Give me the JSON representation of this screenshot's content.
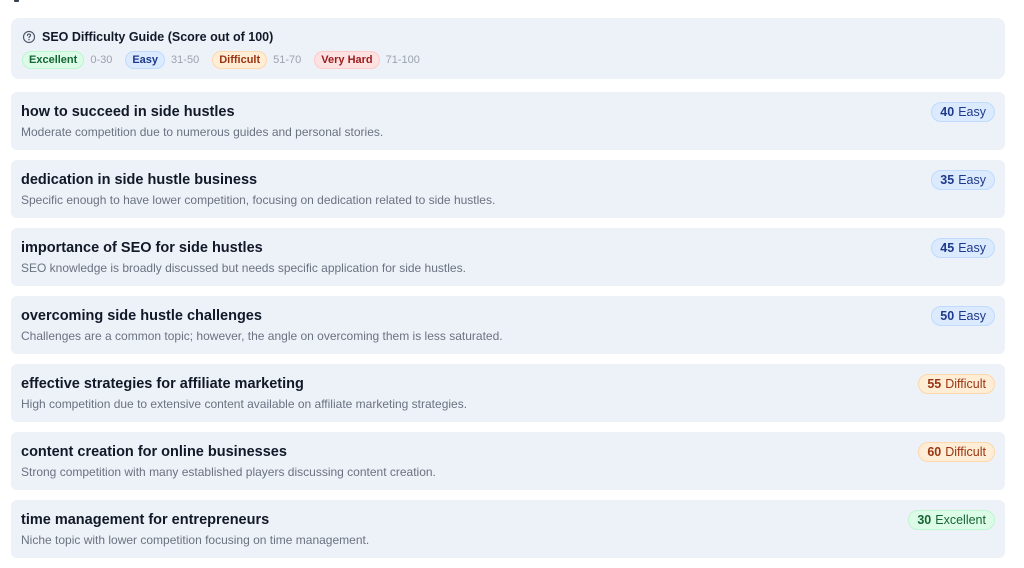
{
  "guide": {
    "title": "SEO Difficulty Guide (Score out of 100)",
    "levels": [
      {
        "label": "Excellent",
        "range": "0-30",
        "bg": "#dcfce7",
        "fg": "#166534",
        "border": "#bbf7d0"
      },
      {
        "label": "Easy",
        "range": "31-50",
        "bg": "#dbeafe",
        "fg": "#1e3a8a",
        "border": "#bfdbfe"
      },
      {
        "label": "Difficult",
        "range": "51-70",
        "bg": "#ffedd5",
        "fg": "#9a3412",
        "border": "#fed7aa"
      },
      {
        "label": "Very Hard",
        "range": "71-100",
        "bg": "#fee2e2",
        "fg": "#991b1b",
        "border": "#fecaca"
      }
    ],
    "icon": "help-circle-icon"
  },
  "keywords": [
    {
      "title": "how to succeed in side hustles",
      "description": "Moderate competition due to numerous guides and personal stories.",
      "score": "40",
      "level": "Easy"
    },
    {
      "title": "dedication in side hustle business",
      "description": "Specific enough to have lower competition, focusing on dedication related to side hustles.",
      "score": "35",
      "level": "Easy"
    },
    {
      "title": "importance of SEO for side hustles",
      "description": "SEO knowledge is broadly discussed but needs specific application for side hustles.",
      "score": "45",
      "level": "Easy"
    },
    {
      "title": "overcoming side hustle challenges",
      "description": "Challenges are a common topic; however, the angle on overcoming them is less saturated.",
      "score": "50",
      "level": "Easy"
    },
    {
      "title": "effective strategies for affiliate marketing",
      "description": "High competition due to extensive content available on affiliate marketing strategies.",
      "score": "55",
      "level": "Difficult"
    },
    {
      "title": "content creation for online businesses",
      "description": "Strong competition with many established players discussing content creation.",
      "score": "60",
      "level": "Difficult"
    },
    {
      "title": "time management for entrepreneurs",
      "description": "Niche topic with lower competition focusing on time management.",
      "score": "30",
      "level": "Excellent"
    }
  ]
}
